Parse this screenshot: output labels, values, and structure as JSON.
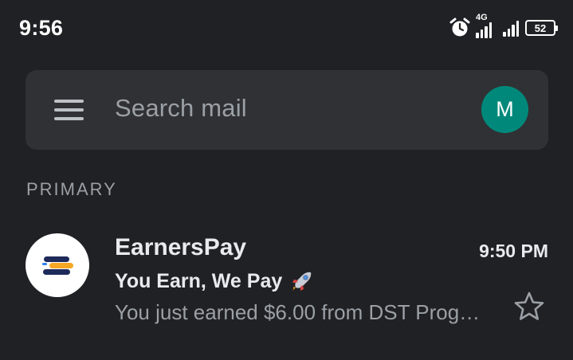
{
  "status_bar": {
    "time": "9:56",
    "network_label": "4G",
    "battery_level": "52",
    "icons": [
      "alarm-icon",
      "signal-4g-icon",
      "signal-icon",
      "battery-icon"
    ]
  },
  "search": {
    "placeholder": "Search mail",
    "avatar_letter": "M",
    "avatar_color": "#00897b",
    "menu_icon": "menu-icon"
  },
  "section": {
    "label": "PRIMARY"
  },
  "emails": [
    {
      "sender": "EarnersPay",
      "time": "9:50 PM",
      "subject": "You Earn, We Pay",
      "subject_emoji": "rocket-icon",
      "snippet": "You just earned $6.00 from DST Prog…",
      "starred": false,
      "sender_logo": "earnerspay-logo"
    }
  ],
  "colors": {
    "background": "#202124",
    "search_bar": "#303134",
    "primary_text": "#e8eaed",
    "secondary_text": "#9aa0a6",
    "logo_navy": "#1e2a5a",
    "logo_orange": "#f5a623",
    "logo_blue": "#2f80ed"
  }
}
